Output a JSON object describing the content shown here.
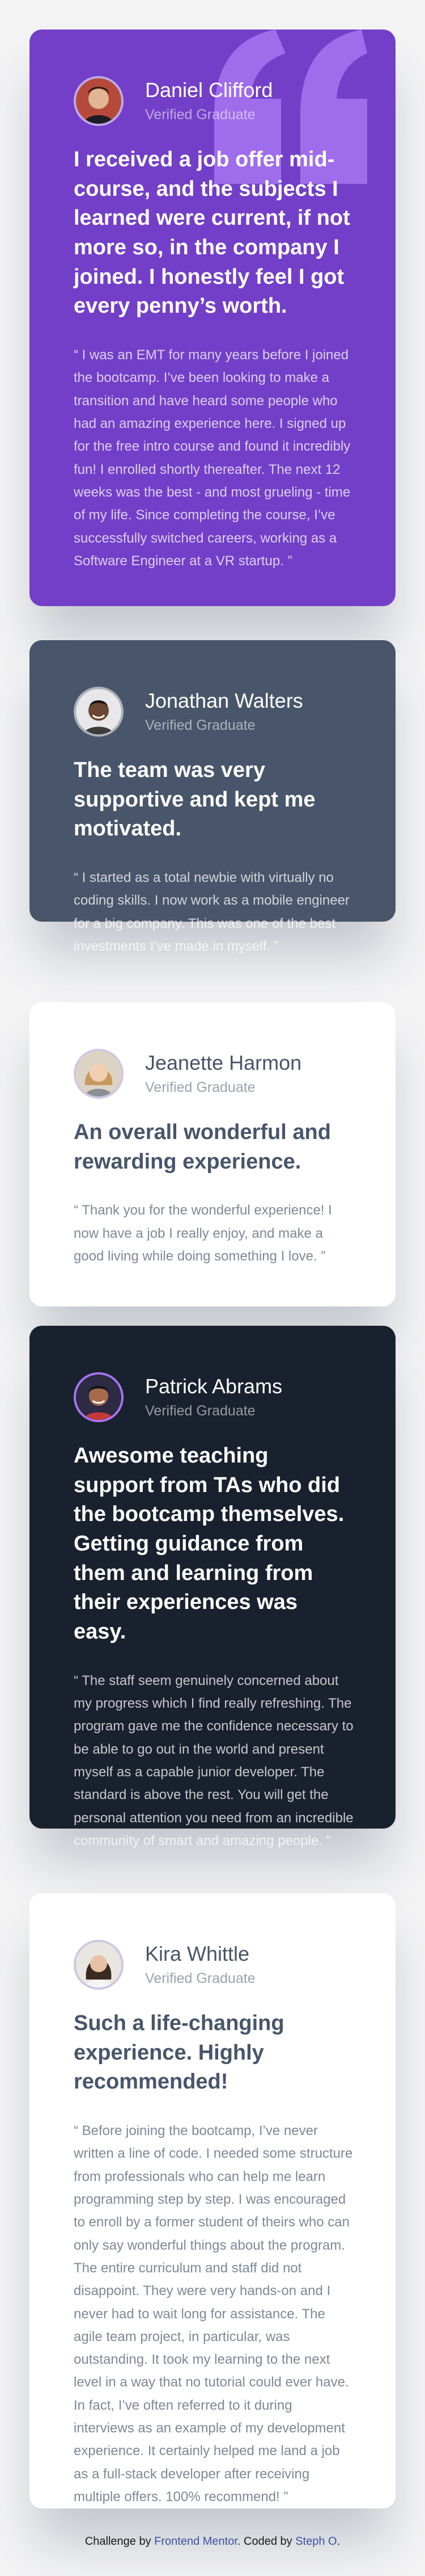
{
  "testimonials": [
    {
      "name": "Daniel Clifford",
      "role": "Verified Graduate",
      "headline": "I received a job offer mid-course, and the subjects I learned were current, if not more so, in the company I joined. I honestly feel I got every penny’s worth.",
      "body": "“ I was an EMT for many years before I joined the bootcamp. I’ve been looking to make a transition and have heard some people who had an amazing experience here. I signed up for the free intro course and found it incredibly fun! I enrolled shortly thereafter. The next 12 weeks was the best - and most grueling - time of my life. Since completing the course, I’ve successfully switched careers, working as a Software Engineer at a VR startup. ”",
      "card_color": "#733fc8"
    },
    {
      "name": "Jonathan Walters",
      "role": "Verified Graduate",
      "headline": "The team was very supportive and kept me motivated.",
      "body": "“ I started as a total newbie with virtually no coding skills. I now work as a mobile engineer for a big company. This was one of the best investments I’ve made in myself. ”",
      "card_color": "#48556a"
    },
    {
      "name": "Jeanette Harmon",
      "role": "Verified Graduate",
      "headline": "An overall wonderful and rewarding experience.",
      "body": "“ Thank you for the wonderful experience! I now have a job I really enjoy, and make a good living while doing something I love. ”",
      "card_color": "#ffffff"
    },
    {
      "name": "Patrick Abrams",
      "role": "Verified Graduate",
      "headline": "Awesome teaching support from TAs who did the bootcamp themselves. Getting guidance from them and learning from their experiences was easy.",
      "body": "“ The staff seem genuinely concerned about my progress which I find really refreshing. The program gave me the confidence necessary to be able to go out in the world and present myself as a capable junior developer. The standard is above the rest. You will get the personal attention you need from an incredible community of smart and amazing people. ”",
      "card_color": "#19212e"
    },
    {
      "name": "Kira Whittle",
      "role": "Verified Graduate",
      "headline": "Such a life-changing experience. Highly recommended!",
      "body": "“ Before joining the bootcamp, I’ve never written a line of code. I needed some structure from professionals who can help me learn programming step by step. I was encouraged to enroll by a former student of theirs who can only say wonderful things about the program. The entire curriculum and staff did not disappoint. They were very hands-on and I never had to wait long for assistance. The agile team project, in particular, was outstanding. It took my learning to the next level in a way that no tutorial could ever have. In fact, I’ve often referred to it during interviews as an example of my development experience. It certainly helped me land a job as a full-stack developer after receiving multiple offers. 100% recommend! ”",
      "card_color": "#ffffff"
    }
  ],
  "attribution": {
    "prefix": "Challenge by ",
    "link1": "Frontend Mentor",
    "middle": ". Coded by ",
    "link2": "Steph O",
    "suffix": "."
  },
  "icons": {
    "quote": "quotation-mark-icon"
  }
}
